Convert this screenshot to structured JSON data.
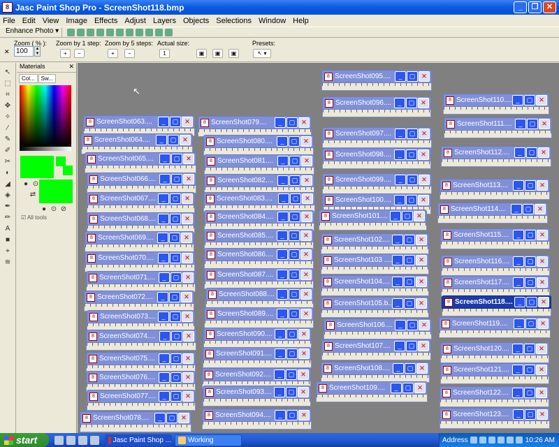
{
  "app": {
    "title": "Jasc Paint Shop Pro - ScreenShot118.bmp"
  },
  "menu": [
    "File",
    "Edit",
    "View",
    "Image",
    "Effects",
    "Adjust",
    "Layers",
    "Objects",
    "Selections",
    "Window",
    "Help"
  ],
  "toolbar": {
    "enhance_label": "Enhance Photo"
  },
  "tool_options": {
    "zoom_label": "Zoom ( % ):",
    "zoom_value": "100",
    "zoom1_label": "Zoom by 1 step:",
    "zoom5_label": "Zoom by 5 steps:",
    "actual_label": "Actual size:",
    "presets_label": "Presets:"
  },
  "materials": {
    "title": "Materials",
    "tab1": "Col...",
    "tab2": "Sw...",
    "all_tools": "All tools",
    "fg_color": "#00ff00"
  },
  "image_windows": [
    "ScreenShot063....",
    "ScreenShot064....",
    "ScreenShot065....",
    "ScreenShot066....",
    "ScreenShot067....",
    "ScreenShot068....",
    "ScreenShot069....",
    "ScreenShot070....",
    "ScreenShot071....",
    "ScreenShot072....",
    "ScreenShot073....",
    "ScreenShot074....",
    "ScreenShot075....",
    "ScreenShot076....",
    "ScreenShot077....",
    "ScreenShot078....",
    "ScreenShot079....",
    "ScreenShot080....",
    "ScreenShot081....",
    "ScreenShot082....",
    "ScreenShot083....",
    "ScreenShot084....",
    "ScreenShot085....",
    "ScreenShot086....",
    "ScreenShot087....",
    "ScreenShot088....",
    "ScreenShot089....",
    "ScreenShot090....",
    "ScreenShot091....",
    "ScreenShot092....",
    "ScreenShot093....",
    "ScreenShot094....",
    "ScreenShot095....",
    "ScreenShot096....",
    "ScreenShot097....",
    "ScreenShot098....",
    "ScreenShot099....",
    "ScreenShot100....",
    "ScreenShot101....",
    "ScreenShot102....",
    "ScreenShot103 ....",
    "ScreenShot104....",
    "ScreenShot105.b....",
    "ScreenShot106....",
    "ScreenShot107....",
    "ScreenShot108....",
    "ScreenShot109....",
    "ScreenShot110....",
    "ScreenShot111....",
    "ScreenShot112....",
    "ScreenShot113....",
    "ScreenShot114....",
    "ScreenShot115....",
    "ScreenShot116....",
    "ScreenShot117....",
    "ScreenShot118....",
    "ScreenShot119....",
    "ScreenShot120....",
    "ScreenShot121....",
    "ScreenShot122....",
    "ScreenShot123...."
  ],
  "active_window": "ScreenShot118....",
  "taskbar": {
    "start": "start",
    "tasks": [
      "Jasc Paint Shop ...",
      "Working"
    ],
    "address_label": "Address",
    "clock": "10:26 AM"
  }
}
